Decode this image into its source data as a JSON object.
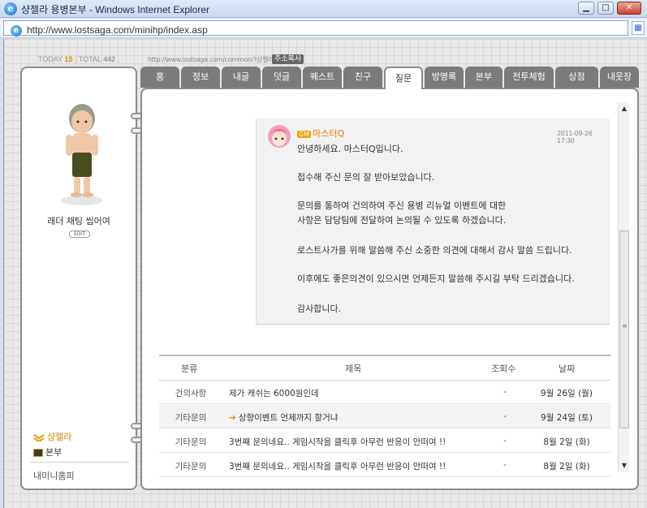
{
  "window": {
    "title": "샹젤라 용병본부 - Windows Internet Explorer",
    "address": "http://www.lostsaga.com/minihp/index.asp",
    "min_label": "▁",
    "max_label": "□",
    "close_label": "✕"
  },
  "header": {
    "today_label": "TODAY",
    "today_value": "15",
    "total_label": "TOTAL",
    "total_value": "442",
    "small_url": "http://www.lostsaga.com/common/?샹젤라",
    "copy_label": "주소복사"
  },
  "profile": {
    "nickname": "래더 채팅 씹어여",
    "edit_label": "EDIT",
    "owner_link": "샹젤라",
    "hq_link": "본부",
    "mini_link": "내미니홈피"
  },
  "tabs": [
    {
      "label": "홈",
      "active": false
    },
    {
      "label": "정보",
      "active": false
    },
    {
      "label": "내글",
      "active": false
    },
    {
      "label": "덧글",
      "active": false
    },
    {
      "label": "퀘스트",
      "active": false
    },
    {
      "label": "친구",
      "active": false
    },
    {
      "label": "질문",
      "active": true
    },
    {
      "label": "방명록",
      "active": false
    },
    {
      "label": "본부",
      "active": false
    },
    {
      "label": "전투체험",
      "active": false
    },
    {
      "label": "상점",
      "active": false
    },
    {
      "label": "내옷장",
      "active": false
    }
  ],
  "answer": {
    "gm_badge": "GM",
    "gm_name": "마스터Q",
    "date": "2011-09-26 17:30",
    "lines": [
      "안녕하세요. 마스터Q입니다.",
      "접수해 주신 문의 잘 받아보았습니다.",
      "문의를 통하여 건의하여 주신 용병 리뉴얼 이벤트에 대한",
      "사항은 담당팀에 전달하여 논의될 수 있도록 하겠습니다.",
      "로스트사가를 위해 말씀해 주신 소중한 의견에 대해서 감사 말씀 드립니다.",
      "이후에도 좋은의견이  있으시면 언제든지 말씀해 주시길 부탁 드리겠습니다.",
      "감사합니다."
    ]
  },
  "table": {
    "headers": {
      "category": "분류",
      "title": "제목",
      "views": "조회수",
      "date": "날짜"
    },
    "rows": [
      {
        "category": "건의사항",
        "title": "제가 캐쉬는 6000원인데",
        "views": "-",
        "date": "9월 26일 (월)",
        "arrow": false
      },
      {
        "category": "기타문의",
        "title": "상향이벤트 언제까지 할거냐",
        "views": "-",
        "date": "9월 24일 (토)",
        "arrow": true
      },
      {
        "category": "기타문의",
        "title": "3번째 문의네요.. 게임시작을 클릭후 아무런 반응이 안떠여 !!",
        "views": "-",
        "date": "8월 2일 (화)",
        "arrow": false
      },
      {
        "category": "기타문의",
        "title": "3번째 문의네요.. 게임시작을 클릭후 아무런 반응이 안떠여 !!",
        "views": "-",
        "date": "8월 2일 (화)",
        "arrow": false
      }
    ]
  },
  "scroll": {
    "up": "▲",
    "down": "▼"
  },
  "colors": {
    "accent_orange": "#f08a00",
    "tab_gray": "#7b7b7b",
    "panel_border": "#8b8b8b"
  }
}
